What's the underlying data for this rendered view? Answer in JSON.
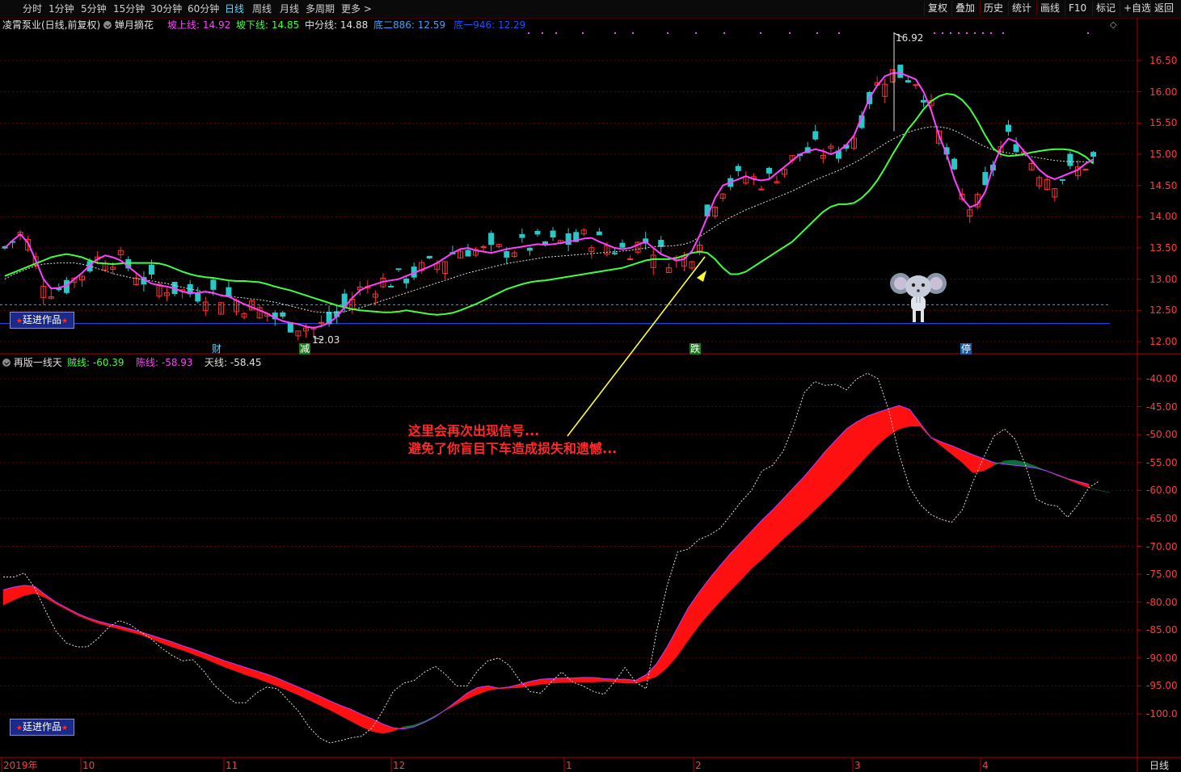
{
  "toolbar": {
    "periods": [
      "分时",
      "1分钟",
      "5分钟",
      "15分钟",
      "30分钟",
      "60分钟",
      "日线",
      "周线",
      "月线",
      "多周期",
      "更多 >"
    ],
    "active": "日线",
    "right_buttons": [
      "复权",
      "叠加",
      "历史",
      "统计",
      "画线",
      "F10",
      "标记",
      "+自选",
      "返回"
    ]
  },
  "top_panel": {
    "stock_title": "凌霄泵业(日线,前复权)",
    "indicator_name": "婵月摘花",
    "legend": [
      {
        "label": "坡上线: 14.92",
        "color": "#ff40ff"
      },
      {
        "label": "坡下线: 14.85",
        "color": "#40ff40"
      },
      {
        "label": "中分线: 14.88",
        "color": "#e0e0e0"
      },
      {
        "label": "底二886: 12.59",
        "color": "#40a0ff"
      },
      {
        "label": "底一946: 12.29",
        "color": "#2050ff"
      }
    ],
    "price_ticks": [
      "16.50",
      "16.00",
      "15.50",
      "15.00",
      "14.50",
      "14.00",
      "13.50",
      "13.00",
      "12.50",
      "12.00"
    ],
    "high_label": "16.92",
    "low_label": "12.03",
    "event_marks": [
      "财",
      "减",
      "跌",
      "停"
    ],
    "watermark": "廷进作品"
  },
  "bottom_panel": {
    "indicator_name": "再版一线天",
    "legend": [
      {
        "label": "贼线: -60.39",
        "color": "#40ff40"
      },
      {
        "label": "陈线: -58.93",
        "color": "#ff40ff"
      },
      {
        "label": "天线: -58.45",
        "color": "#e0e0e0"
      }
    ],
    "value_ticks": [
      "-40.00",
      "-45.00",
      "-50.00",
      "-55.00",
      "-60.00",
      "-65.00",
      "-70.00",
      "-75.00",
      "-80.00",
      "-85.00",
      "-90.00",
      "-95.00",
      "-100.0"
    ],
    "watermark": "廷进作品"
  },
  "annotation": {
    "line1": "这里会再次出现信号...",
    "line2": "避免了你盲目下车造成损失和遗憾..."
  },
  "time_axis": {
    "labels": [
      "2019年",
      "10",
      "11",
      "12",
      "1",
      "2",
      "3",
      "4"
    ],
    "period": "日线"
  },
  "colors": {
    "up": "#ff3232",
    "down": "#28c8c8",
    "grid": "#6a0000",
    "axis": "#b00000"
  },
  "chart_data": [
    {
      "type": "candlestick",
      "title": "凌霄泵业(日线,前复权)",
      "ylim": [
        11.85,
        16.95
      ],
      "series": [
        {
          "name": "坡上线",
          "color": "#ff40ff",
          "values": [
            13.5,
            13.62,
            13.72,
            13.58,
            13.3,
            13.0,
            12.85,
            12.86,
            12.9,
            13.0,
            13.1,
            13.22,
            13.32,
            13.38,
            13.35,
            13.3,
            13.2,
            13.1,
            13.0,
            12.93,
            12.9,
            12.88,
            12.85,
            12.8,
            12.78,
            12.78,
            12.8,
            12.78,
            12.74,
            12.72,
            12.66,
            12.6,
            12.55,
            12.5,
            12.45,
            12.38,
            12.33,
            12.3,
            12.28,
            12.24,
            12.22,
            12.25,
            12.3,
            12.4,
            12.55,
            12.7,
            12.82,
            12.88,
            12.92,
            12.96,
            12.98,
            13.0,
            13.05,
            13.1,
            13.15,
            13.2,
            13.26,
            13.34,
            13.42,
            13.48,
            13.5,
            13.46,
            13.44,
            13.42,
            13.45,
            13.48,
            13.5,
            13.52,
            13.54,
            13.56,
            13.55,
            13.56,
            13.58,
            13.6,
            13.62,
            13.65,
            13.66,
            13.6,
            13.55,
            13.5,
            13.48,
            13.5,
            13.55,
            13.6,
            13.5,
            13.4,
            13.35,
            13.3,
            13.32,
            13.45,
            13.7,
            14.0,
            14.3,
            14.5,
            14.55,
            14.6,
            14.65,
            14.6,
            14.58,
            14.6,
            14.7,
            14.8,
            14.9,
            15.0,
            15.05,
            15.08,
            15.05,
            15.0,
            15.05,
            15.15,
            15.3,
            15.6,
            15.9,
            16.1,
            16.25,
            16.3,
            16.3,
            16.25,
            16.2,
            16.0,
            15.7,
            15.3,
            15.0,
            14.6,
            14.3,
            14.15,
            14.2,
            14.4,
            14.8,
            15.1,
            15.25,
            15.2,
            15.05,
            14.9,
            14.75,
            14.65,
            14.6,
            14.65,
            14.7,
            14.75,
            14.85,
            14.92
          ]
        },
        {
          "name": "坡下线",
          "color": "#40ff40",
          "values": [
            13.05,
            13.1,
            13.15,
            13.2,
            13.25,
            13.3,
            13.35,
            13.38,
            13.4,
            13.38,
            13.35,
            13.3,
            13.26,
            13.25,
            13.24,
            13.25,
            13.26,
            13.26,
            13.26,
            13.26,
            13.25,
            13.22,
            13.17,
            13.12,
            13.08,
            13.05,
            13.03,
            13.02,
            13.0,
            12.98,
            12.97,
            12.97,
            12.96,
            12.95,
            12.92,
            12.88,
            12.85,
            12.82,
            12.78,
            12.74,
            12.7,
            12.66,
            12.62,
            12.58,
            12.55,
            12.52,
            12.5,
            12.49,
            12.48,
            12.47,
            12.47,
            12.48,
            12.5,
            12.48,
            12.46,
            12.44,
            12.43,
            12.44,
            12.46,
            12.5,
            12.55,
            12.6,
            12.66,
            12.72,
            12.78,
            12.84,
            12.88,
            12.92,
            12.95,
            12.97,
            12.98,
            13.0,
            13.02,
            13.04,
            13.06,
            13.08,
            13.1,
            13.12,
            13.14,
            13.16,
            13.18,
            13.22,
            13.26,
            13.3,
            13.32,
            13.32,
            13.32,
            13.34,
            13.38,
            13.42,
            13.44,
            13.42,
            13.32,
            13.18,
            13.08,
            13.08,
            13.12,
            13.2,
            13.28,
            13.36,
            13.44,
            13.52,
            13.6,
            13.72,
            13.84,
            13.96,
            14.08,
            14.16,
            14.2,
            14.2,
            14.22,
            14.3,
            14.42,
            14.58,
            14.78,
            15.0,
            15.2,
            15.4,
            15.55,
            15.72,
            15.85,
            15.93,
            15.97,
            15.95,
            15.87,
            15.73,
            15.53,
            15.3,
            15.1,
            15.0,
            14.97,
            14.98,
            15.0,
            15.03,
            15.05,
            15.07,
            15.08,
            15.08,
            15.07,
            15.03,
            14.96,
            14.85
          ]
        },
        {
          "name": "中分线",
          "color": "#e0e0e0",
          "values": [
            13.0,
            13.07,
            13.12,
            13.17,
            13.21,
            13.24,
            13.25,
            13.26,
            13.26,
            13.26,
            13.24,
            13.21,
            13.17,
            13.13,
            13.09,
            13.06,
            13.03,
            13.01,
            12.99,
            12.97,
            12.95,
            12.93,
            12.9,
            12.87,
            12.84,
            12.82,
            12.79,
            12.77,
            12.75,
            12.73,
            12.71,
            12.7,
            12.68,
            12.67,
            12.65,
            12.63,
            12.6,
            12.57,
            12.54,
            12.51,
            12.48,
            12.47,
            12.46,
            12.47,
            12.48,
            12.51,
            12.54,
            12.58,
            12.62,
            12.66,
            12.7,
            12.74,
            12.78,
            12.82,
            12.86,
            12.9,
            12.94,
            12.98,
            13.02,
            13.06,
            13.1,
            13.13,
            13.16,
            13.19,
            13.22,
            13.25,
            13.27,
            13.29,
            13.31,
            13.33,
            13.35,
            13.36,
            13.37,
            13.38,
            13.39,
            13.4,
            13.41,
            13.42,
            13.43,
            13.44,
            13.45,
            13.46,
            13.48,
            13.5,
            13.52,
            13.53,
            13.53,
            13.54,
            13.56,
            13.6,
            13.68,
            13.76,
            13.84,
            13.92,
            13.99,
            14.05,
            14.11,
            14.16,
            14.21,
            14.26,
            14.31,
            14.36,
            14.41,
            14.47,
            14.53,
            14.59,
            14.64,
            14.69,
            14.74,
            14.8,
            14.86,
            14.93,
            15.01,
            15.09,
            15.17,
            15.24,
            15.3,
            15.35,
            15.39,
            15.42,
            15.44,
            15.44,
            15.42,
            15.38,
            15.32,
            15.25,
            15.18,
            15.12,
            15.07,
            15.04,
            15.02,
            15.0,
            14.98,
            14.96,
            14.94,
            14.92,
            14.9,
            14.89,
            14.88,
            14.88,
            14.88,
            14.88
          ]
        }
      ],
      "reference_levels": [
        {
          "name": "底二886",
          "value": 12.59,
          "color": "#40a0ff"
        },
        {
          "name": "底一946",
          "value": 12.29,
          "color": "#2050ff"
        }
      ]
    },
    {
      "type": "area",
      "title": "再版一线天",
      "ylim": [
        -104,
        -37.5
      ],
      "series": [
        {
          "name": "贼线",
          "color": "#40ff40",
          "values": [
            -80.5,
            -79.6,
            -78.8,
            -78.4,
            -79.2,
            -80.3,
            -81.3,
            -82.3,
            -83.1,
            -83.8,
            -84.3,
            -84.8,
            -85.3,
            -85.8,
            -86.5,
            -87.3,
            -88.0,
            -88.6,
            -89.3,
            -90.0,
            -90.8,
            -91.6,
            -92.3,
            -93.0,
            -93.6,
            -94.3,
            -95.0,
            -95.8,
            -96.6,
            -97.5,
            -98.4,
            -99.3,
            -100.3,
            -101.3,
            -102.3,
            -103.1,
            -103.5,
            -103.1,
            -102.3,
            -102.0,
            -101.3,
            -100.3,
            -99.3,
            -98.3,
            -97.3,
            -96.5,
            -95.8,
            -95.5,
            -95.4,
            -95.3,
            -95.0,
            -94.7,
            -94.5,
            -94.4,
            -94.3,
            -94.3,
            -94.3,
            -94.2,
            -94.3,
            -94.5,
            -94.5,
            -94.0,
            -93.3,
            -91.7,
            -89.5,
            -86.8,
            -84.2,
            -82.0,
            -79.9,
            -77.9,
            -76.0,
            -74.0,
            -72.3,
            -70.5,
            -68.7,
            -67.0,
            -65.3,
            -63.5,
            -61.7,
            -59.8,
            -57.8,
            -55.8,
            -53.7,
            -51.8,
            -50.2,
            -49.0,
            -48.5,
            -48.5,
            -50.5,
            -52.0,
            -53.5,
            -55.0,
            -56.8,
            -56.5,
            -55.5,
            -54.7,
            -54.6,
            -55.0,
            -55.7,
            -56.5,
            -57.3,
            -58.0,
            -58.8,
            -59.5,
            -60.0,
            -60.4
          ]
        },
        {
          "name": "陈线",
          "color": "#ff40ff",
          "values": [
            -77.8,
            -77.3,
            -77.0,
            -77.2,
            -78.7,
            -80.0,
            -81.0,
            -82.0,
            -82.8,
            -83.4,
            -83.9,
            -84.3,
            -84.8,
            -85.3,
            -85.9,
            -86.5,
            -87.1,
            -87.8,
            -88.4,
            -89.1,
            -89.8,
            -90.5,
            -91.1,
            -91.7,
            -92.3,
            -92.9,
            -93.6,
            -94.4,
            -95.2,
            -96.0,
            -96.8,
            -97.7,
            -98.5,
            -99.2,
            -100.1,
            -100.9,
            -101.8,
            -102.5,
            -102.7,
            -102.3,
            -101.5,
            -100.5,
            -99.2,
            -97.8,
            -96.3,
            -95.3,
            -95.0,
            -95.4,
            -95.2,
            -94.7,
            -94.2,
            -93.8,
            -93.7,
            -93.6,
            -93.6,
            -93.5,
            -93.5,
            -93.7,
            -93.8,
            -93.8,
            -94.0,
            -93.0,
            -91.0,
            -88.0,
            -84.5,
            -81.0,
            -78.3,
            -75.8,
            -73.5,
            -71.3,
            -69.3,
            -67.3,
            -65.3,
            -63.5,
            -61.5,
            -59.5,
            -57.5,
            -55.3,
            -53.0,
            -51.0,
            -49.0,
            -47.7,
            -46.7,
            -46.0,
            -45.4,
            -44.8,
            -45.5,
            -48.0,
            -50.5,
            -51.3,
            -52.0,
            -52.8,
            -53.6,
            -54.3,
            -55.0,
            -55.3,
            -55.5,
            -55.7,
            -56.0,
            -56.5,
            -57.2,
            -57.9,
            -58.4,
            -58.9
          ]
        },
        {
          "name": "天线",
          "color": "#e0e0e0",
          "values": [
            -75.5,
            -75.5,
            -74.8,
            -77.5,
            -81.5,
            -85.2,
            -87.3,
            -88.0,
            -88.0,
            -86.5,
            -84.5,
            -83.3,
            -84.0,
            -85.3,
            -86.5,
            -88.2,
            -89.5,
            -90.5,
            -90.3,
            -92.3,
            -94.8,
            -96.5,
            -98.0,
            -98.0,
            -96.3,
            -95.2,
            -95.5,
            -97.5,
            -99.5,
            -102.3,
            -104.3,
            -105.2,
            -104.8,
            -104.3,
            -104.0,
            -102.5,
            -99.5,
            -96.0,
            -94.5,
            -94.0,
            -92.5,
            -91.5,
            -93.0,
            -95.0,
            -95.0,
            -92.3,
            -90.5,
            -90.0,
            -91.3,
            -94.0,
            -96.0,
            -96.3,
            -94.3,
            -92.5,
            -94.3,
            -95.0,
            -96.0,
            -96.5,
            -94.3,
            -91.7,
            -94.3,
            -95.5,
            -85.2,
            -77.0,
            -71.0,
            -70.5,
            -68.8,
            -68.0,
            -66.8,
            -64.5,
            -62.0,
            -60.0,
            -56.5,
            -55.5,
            -53.0,
            -48.3,
            -42.5,
            -40.5,
            -41.2,
            -41.0,
            -42.0,
            -40.0,
            -39.0,
            -40.0,
            -45.5,
            -53.5,
            -59.5,
            -62.5,
            -64.3,
            -65.2,
            -65.7,
            -63.5,
            -58.5,
            -54.2,
            -50.3,
            -49.0,
            -50.8,
            -55.5,
            -61.5,
            -62.5,
            -62.8,
            -64.8,
            -62.5,
            -59.5,
            -58.3
          ]
        }
      ]
    }
  ]
}
